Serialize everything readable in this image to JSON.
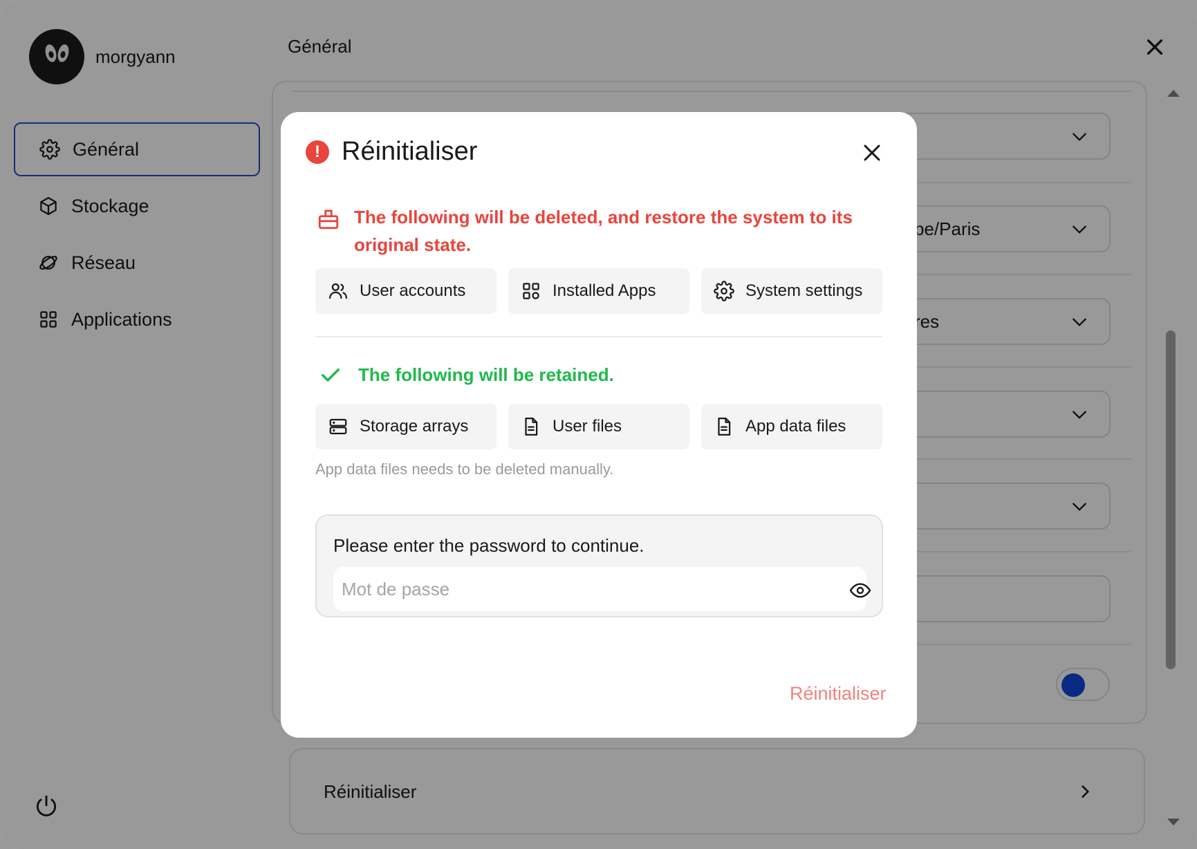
{
  "profile": {
    "name": "morgyann"
  },
  "sidebar": {
    "items": [
      {
        "label": "Général",
        "icon": "gear-icon",
        "active": true
      },
      {
        "label": "Stockage",
        "icon": "cube-icon"
      },
      {
        "label": "Réseau",
        "icon": "planet-icon"
      },
      {
        "label": "Applications",
        "icon": "grid-icon"
      }
    ]
  },
  "main": {
    "title": "Général",
    "selects": [
      "",
      "pe/Paris",
      "res",
      "",
      ""
    ],
    "reset_row_label": "Réinitialiser"
  },
  "modal": {
    "title": "Réinitialiser",
    "delete_message": "The following will be deleted, and restore the system to its original state.",
    "deleted_items": [
      "User accounts",
      "Installed Apps",
      "System settings"
    ],
    "retain_message": "The following will be retained.",
    "retained_items": [
      "Storage arrays",
      "User files",
      "App data files"
    ],
    "hint": "App data files needs to be deleted manually.",
    "password_label": "Please enter the password to continue.",
    "password_placeholder": "Mot de passe",
    "action_label": "Réinitialiser"
  },
  "colors": {
    "accent": "#1245d6",
    "danger": "#e8453c",
    "success": "#1fba4a",
    "action_disabled": "#f0837c"
  }
}
